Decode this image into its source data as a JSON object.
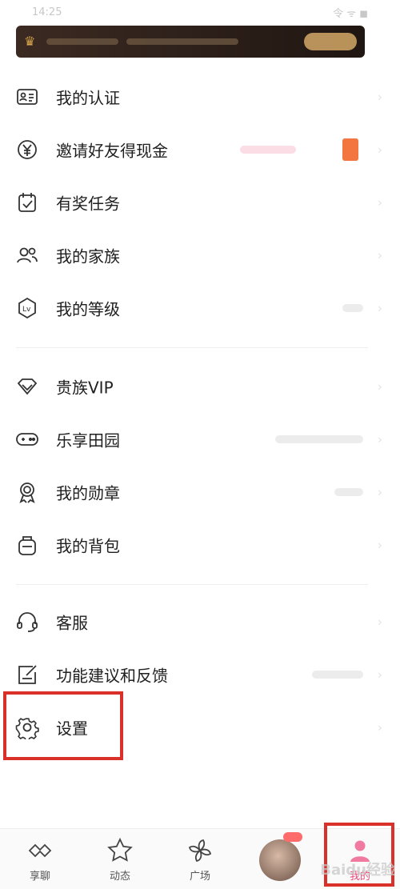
{
  "status_bar": {
    "time": "14:25",
    "signals": "令 ᯤ ◼"
  },
  "menu": {
    "items": [
      {
        "label": "我的认证",
        "icon": "id-card-icon"
      },
      {
        "label": "邀请好友得现金",
        "icon": "yen-coin-icon"
      },
      {
        "label": "有奖任务",
        "icon": "task-calendar-icon"
      },
      {
        "label": "我的家族",
        "icon": "family-users-icon"
      },
      {
        "label": "我的等级",
        "icon": "level-badge-icon"
      },
      {
        "label": "贵族VIP",
        "icon": "diamond-vip-icon"
      },
      {
        "label": "乐享田园",
        "icon": "gamepad-icon"
      },
      {
        "label": "我的勋章",
        "icon": "medal-icon"
      },
      {
        "label": "我的背包",
        "icon": "backpack-icon"
      },
      {
        "label": "客服",
        "icon": "headset-icon"
      },
      {
        "label": "功能建议和反馈",
        "icon": "feedback-edit-icon"
      },
      {
        "label": "设置",
        "icon": "gear-icon"
      }
    ]
  },
  "tabbar": {
    "tabs": [
      {
        "label": "享聊",
        "icon": "chat-bubbles-icon"
      },
      {
        "label": "动态",
        "icon": "star-icon"
      },
      {
        "label": "广场",
        "icon": "pinwheel-icon"
      },
      {
        "label": "",
        "icon": "avatar"
      },
      {
        "label": "我的",
        "icon": "profile-icon"
      }
    ]
  },
  "colors": {
    "accent": "#e94b7b",
    "highlight": "#d9302a"
  },
  "watermark": "Baidu经验"
}
